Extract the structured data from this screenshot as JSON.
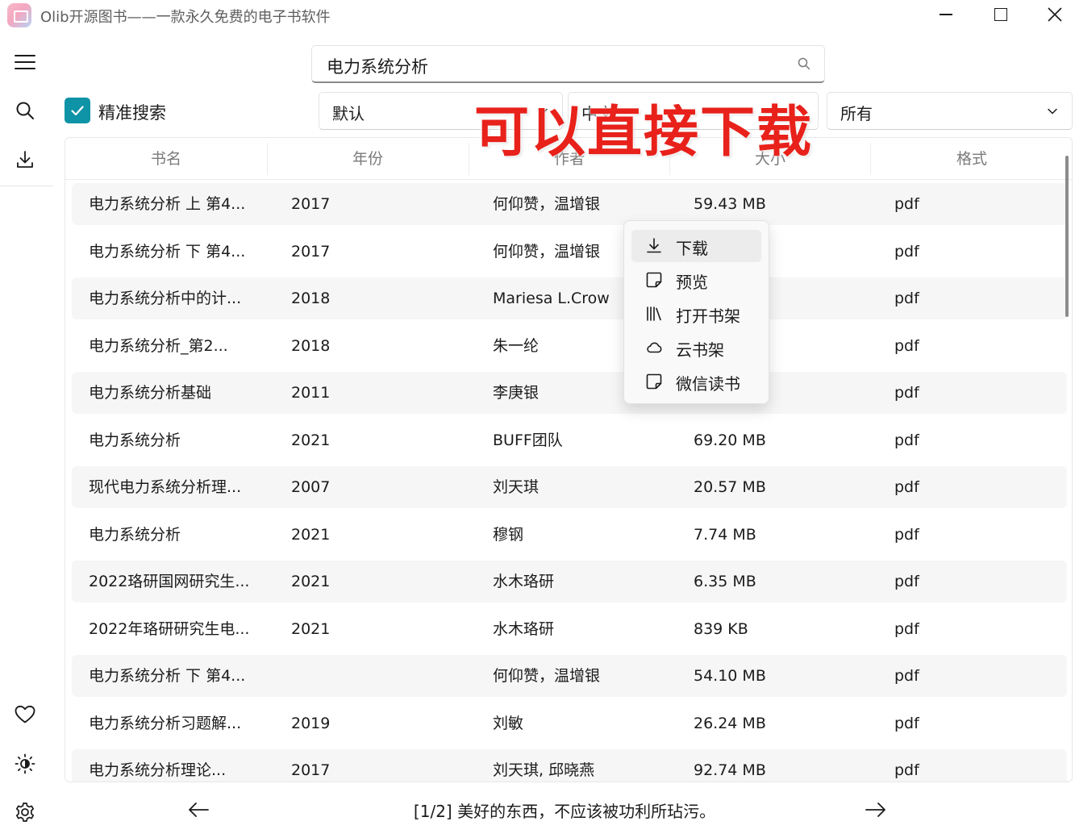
{
  "window": {
    "title": "Olib开源图书——一款永久免费的电子书软件"
  },
  "search": {
    "query": "电力系统分析"
  },
  "filters": {
    "exact_label": "精准搜索",
    "exact_checked": true,
    "sort_value": "默认",
    "language_value": "中文",
    "format_value": "所有"
  },
  "overlay_text": "可以直接下载",
  "table": {
    "headers": [
      "书名",
      "年份",
      "作者",
      "大小",
      "格式"
    ],
    "rows": [
      {
        "title": "电力系统分析 上 第4...",
        "year": "2017",
        "author": "何仰赞，温增银",
        "size": "59.43 MB",
        "format": "pdf"
      },
      {
        "title": "电力系统分析 下 第4...",
        "year": "2017",
        "author": "何仰赞，温增银",
        "size": "",
        "format": "pdf"
      },
      {
        "title": "电力系统分析中的计...",
        "year": "2018",
        "author": "Mariesa L.Crow",
        "size": "",
        "format": "pdf"
      },
      {
        "title": "电力系统分析_第2...",
        "year": "2018",
        "author": "朱一纶",
        "size": "",
        "format": "pdf"
      },
      {
        "title": "电力系统分析基础",
        "year": "2011",
        "author": "李庚银",
        "size": "",
        "format": "pdf"
      },
      {
        "title": "电力系统分析",
        "year": "2021",
        "author": "BUFF团队",
        "size": "69.20 MB",
        "format": "pdf"
      },
      {
        "title": "现代电力系统分析理...",
        "year": "2007",
        "author": "刘天琪",
        "size": "20.57 MB",
        "format": "pdf"
      },
      {
        "title": "电力系统分析",
        "year": "2021",
        "author": "穆钢",
        "size": "7.74 MB",
        "format": "pdf"
      },
      {
        "title": "2022珞研国网研究生...",
        "year": "2021",
        "author": "水木珞研",
        "size": "6.35 MB",
        "format": "pdf"
      },
      {
        "title": "2022年珞研研究生电...",
        "year": "2021",
        "author": "水木珞研",
        "size": "839 KB",
        "format": "pdf"
      },
      {
        "title": "电力系统分析 下 第4...",
        "year": "",
        "author": "何仰赞，温增银",
        "size": "54.10 MB",
        "format": "pdf"
      },
      {
        "title": "电力系统分析习题解...",
        "year": "2019",
        "author": "刘敏",
        "size": "26.24 MB",
        "format": "pdf"
      },
      {
        "title": "电力系统分析理论...",
        "year": "2017",
        "author": "刘天琪, 邱晓燕",
        "size": "92.74 MB",
        "format": "pdf"
      }
    ]
  },
  "context_menu": {
    "items": [
      {
        "label": "下载",
        "icon": "download-icon"
      },
      {
        "label": "预览",
        "icon": "sticky-note-icon"
      },
      {
        "label": "打开书架",
        "icon": "bookshelf-icon"
      },
      {
        "label": "云书架",
        "icon": "cloud-icon"
      },
      {
        "label": "微信读书",
        "icon": "sticky-note-icon"
      }
    ]
  },
  "footer": {
    "quote": "[1/2] 美好的东西，不应该被功利所玷污。"
  },
  "colors": {
    "accent": "#0f93a6",
    "overlay": "#e8211b"
  }
}
